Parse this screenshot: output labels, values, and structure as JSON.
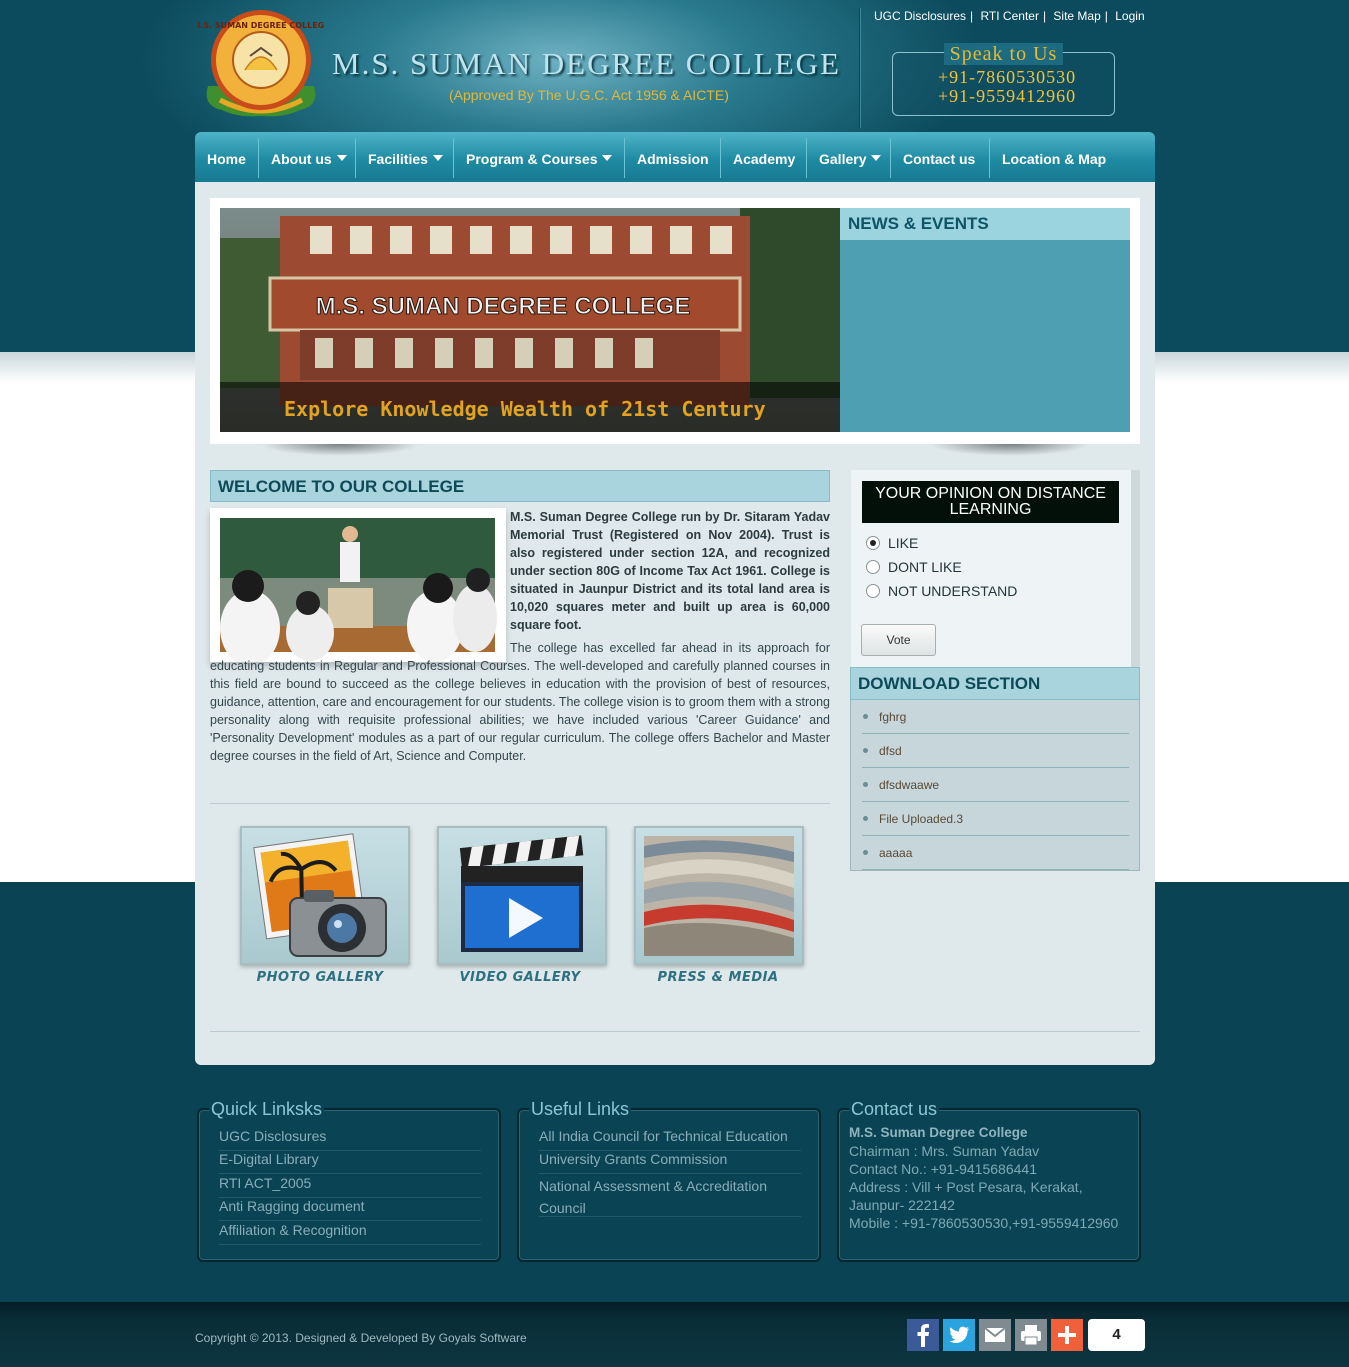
{
  "header": {
    "college_name": "M.S. SUMAN DEGREE COLLEGE",
    "approved": "(Approved By The U.G.C. Act 1956 & AICTE)",
    "logo_text": "M.S. SUMAN DEGREE COLLEGE",
    "top_links": [
      "UGC Disclosures",
      "RTI Center",
      "Site Map",
      "Login"
    ],
    "speak_title": "Speak to Us",
    "phones": [
      "+91-7860530530",
      "+91-9559412960"
    ]
  },
  "nav": {
    "items": [
      "Home",
      "About us",
      "Facilities",
      "Program & Courses",
      "Admission",
      "Academy",
      "Gallery",
      "Contact us",
      "Location & Map"
    ]
  },
  "slider": {
    "banner_text": "M.S. SUMAN DEGREE COLLEGE",
    "caption": "Explore Knowledge Wealth of 21st Century"
  },
  "news": {
    "title": "NEWS & EVENTS"
  },
  "welcome": {
    "title": "WELCOME TO OUR COLLEGE",
    "bold_para": "M.S. Suman Degree College run by Dr. Sitaram Yadav Memorial Trust (Registered on Nov 2004). Trust is also registered under section 12A, and recognized under section 80G of Income Tax Act 1961. College is situated in Jaunpur District and its total land area is 10,020 squares meter and built up area is 60,000 square foot.",
    "para": "The college has excelled far ahead in its approach for educating students in Regular and Professional Courses. The well-developed and carefully planned courses in this field are bound to succeed as the college believes in education with the provision of best of resources, guidance, attention, care and encouragement for our students. The college vision is to groom them with a strong personality along with requisite professional abilities; we have included various 'Career Guidance' and 'Personality Development' modules as a part of our regular curriculum. The college offers Bachelor and Master degree courses in the field of Art, Science and Computer."
  },
  "gallery": {
    "tiles": [
      "PHOTO GALLERY",
      "VIDEO GALLERY",
      "PRESS & MEDIA"
    ]
  },
  "poll": {
    "title": "YOUR OPINION ON DISTANCE LEARNING",
    "options": [
      "LIKE",
      "DONT LIKE",
      "NOT UNDERSTAND"
    ],
    "selected": "LIKE",
    "vote_label": "Vote"
  },
  "downloads": {
    "title": "DOWNLOAD SECTION",
    "items": [
      "fghrg",
      "dfsd",
      "dfsdwaawe",
      "File Uploaded.3",
      "aaaaa"
    ]
  },
  "footer": {
    "quick_links": {
      "title": "Quick Linksks",
      "items": [
        "UGC Disclosures",
        "E-Digital Library",
        "RTI ACT_2005",
        "Anti Ragging document",
        "Affiliation & Recognition"
      ]
    },
    "useful_links": {
      "title": "Useful Links",
      "items": [
        "All India Council for Technical Education",
        "University Grants Commission",
        "National Assessment & Accreditation Council"
      ]
    },
    "contact": {
      "title": "Contact us",
      "name": "M.S. Suman Degree College",
      "lines": [
        "Chairman : Mrs. Suman Yadav",
        "Contact No.: +91-9415686441",
        "Address : Vill + Post Pesara, Kerakat,",
        "Jaunpur- 222142",
        "Mobile : +91-7860530530,+91-9559412960"
      ]
    },
    "copyright": "Copyright © 2013. Designed & Developed By Goyals Software",
    "share_count": "4"
  },
  "colors": {
    "accent": "#1f8ba3",
    "gold": "#e2b735",
    "dark_teal": "#0a4454"
  }
}
